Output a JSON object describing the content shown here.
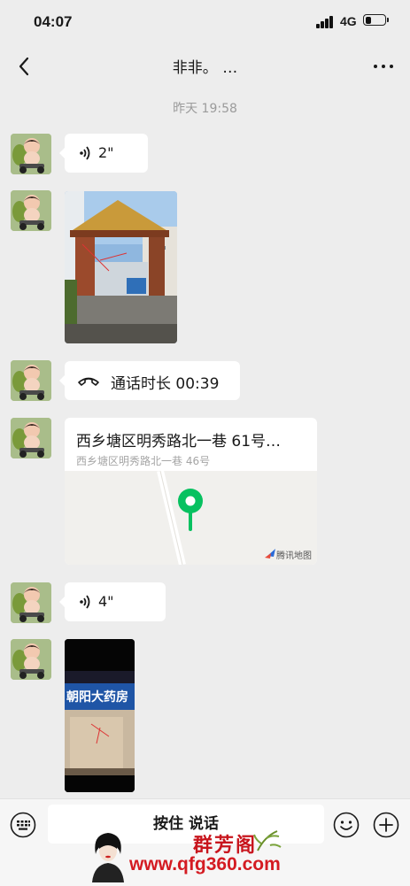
{
  "status_bar": {
    "time": "04:07",
    "network": "4G",
    "battery_level": 0.3
  },
  "nav": {
    "title": "非非。 …"
  },
  "chat": {
    "timestamp": "昨天 19:58",
    "messages": [
      {
        "type": "voice",
        "duration": "2\""
      },
      {
        "type": "image"
      },
      {
        "type": "call",
        "text": "通话时长 00:39"
      },
      {
        "type": "location",
        "name": "西乡塘区明秀路北一巷 61号…",
        "address": "西乡塘区明秀路北一巷 46号",
        "map_credit": "腾讯地图"
      },
      {
        "type": "voice",
        "duration": "4\""
      },
      {
        "type": "image",
        "sign_text": "朝阳大药房"
      }
    ]
  },
  "input_bar": {
    "talk_label": "按住 说话"
  },
  "watermark": {
    "brand": "群芳阁",
    "url": "www.qfg360.com"
  },
  "colors": {
    "background": "#ededed",
    "bubble": "#ffffff",
    "pin": "#07c160",
    "watermark": "#d41b22"
  }
}
